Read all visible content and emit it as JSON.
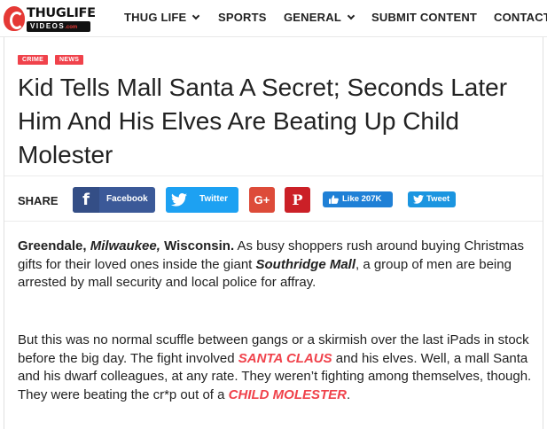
{
  "header": {
    "logo": {
      "word": "THUGLIFE",
      "sub": "VIDEOS",
      "sub_suffix": ".com"
    },
    "nav": [
      {
        "label": "THUG LIFE",
        "has_dropdown": true
      },
      {
        "label": "SPORTS",
        "has_dropdown": false
      },
      {
        "label": "GENERAL",
        "has_dropdown": true
      },
      {
        "label": "SUBMIT CONTENT",
        "has_dropdown": false
      },
      {
        "label": "CONTACT",
        "has_dropdown": false
      }
    ]
  },
  "article": {
    "tags": [
      "CRIME",
      "NEWS"
    ],
    "title": "Kid Tells Mall Santa A Secret; Seconds Later Him And His Elves Are Beating Up Child Molester",
    "share": {
      "label": "SHARE",
      "facebook": "Facebook",
      "twitter": "Twitter",
      "googleplus": "G+",
      "pinterest": "P",
      "like": "Like 207K",
      "tweet": "Tweet"
    },
    "p1": {
      "lead1": "Greendale, ",
      "lead2": "Milwaukee,",
      "lead3": " Wisconsin.",
      "t1": " As busy shoppers rush around buying Christmas gifts for their loved ones inside the giant ",
      "mall": "Southridge Mall",
      "t2": ", a group of men are being arrested by mall security and local police for affray."
    },
    "p2": {
      "t1": "But this was no normal scuffle between gangs or a skirmish over the last iPads in stock before the big day. The fight involved ",
      "santa": "SANTA CLAUS",
      "t2": " and his elves. Well, a mall Santa and his dwarf colleagues, at any rate. They weren’t fighting among themselves, though. They were beating the cr*p out of a ",
      "molester": "CHILD MOLESTER",
      "t3": "."
    }
  },
  "colors": {
    "accent": "#f0424b",
    "facebook": "#3b5998",
    "twitter": "#1da1f2",
    "googleplus": "#dd4b39",
    "pinterest": "#cb2027"
  }
}
